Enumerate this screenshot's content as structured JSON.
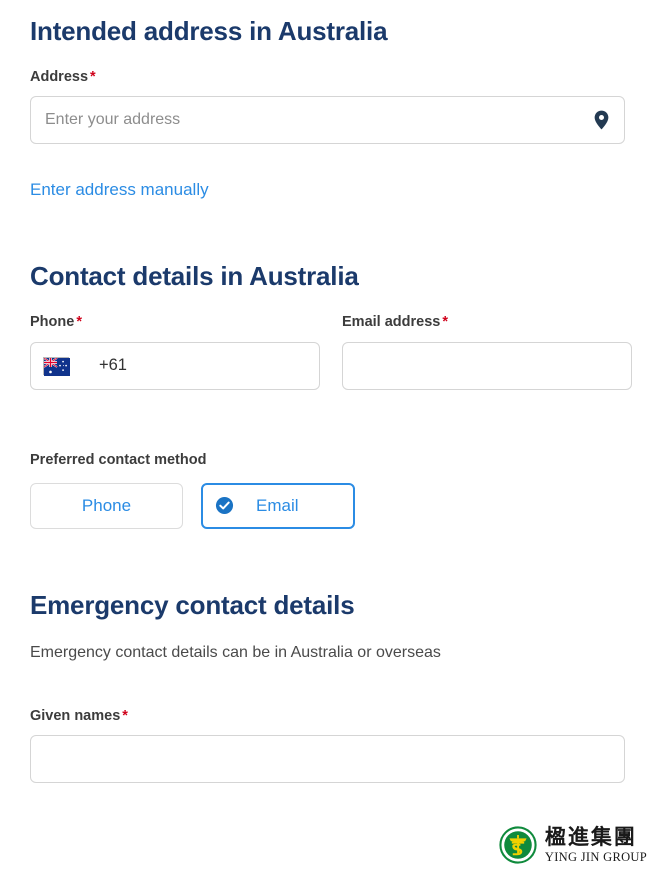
{
  "sections": {
    "address": {
      "heading": "Intended address in Australia",
      "field_label": "Address",
      "required_mark": "*",
      "placeholder": "Enter your address",
      "value": "",
      "pin_icon": "location-pin-icon",
      "manual_link": "Enter address manually"
    },
    "contact": {
      "heading": "Contact details in Australia",
      "phone": {
        "label": "Phone",
        "required_mark": "*",
        "flag_icon": "australia-flag-icon",
        "dial_code": "+61",
        "value": "",
        "placeholder": ""
      },
      "email": {
        "label": "Email address",
        "required_mark": "*",
        "value": "",
        "placeholder": ""
      },
      "preferred": {
        "label": "Preferred contact method",
        "options": [
          {
            "label": "Phone",
            "selected": false
          },
          {
            "label": "Email",
            "selected": true,
            "check_icon": "check-circle-icon"
          }
        ]
      }
    },
    "emergency": {
      "heading": "Emergency contact details",
      "description": "Emergency contact details can be in Australia or overseas",
      "given_names": {
        "label": "Given names",
        "required_mark": "*",
        "value": "",
        "placeholder": ""
      }
    }
  },
  "watermark": {
    "logo_icon": "ying-jin-group-logo",
    "chinese_name": "楹進集團",
    "english_name": "YING JIN GROUP"
  },
  "colors": {
    "heading_navy": "#1b3a6b",
    "link_blue": "#2b8ce4",
    "required_red": "#d0021b",
    "border_grey": "#d5d5d5",
    "placeholder_grey": "#8d8d8d",
    "logo_green": "#0f8a3c",
    "logo_yellow": "#f2d000"
  }
}
